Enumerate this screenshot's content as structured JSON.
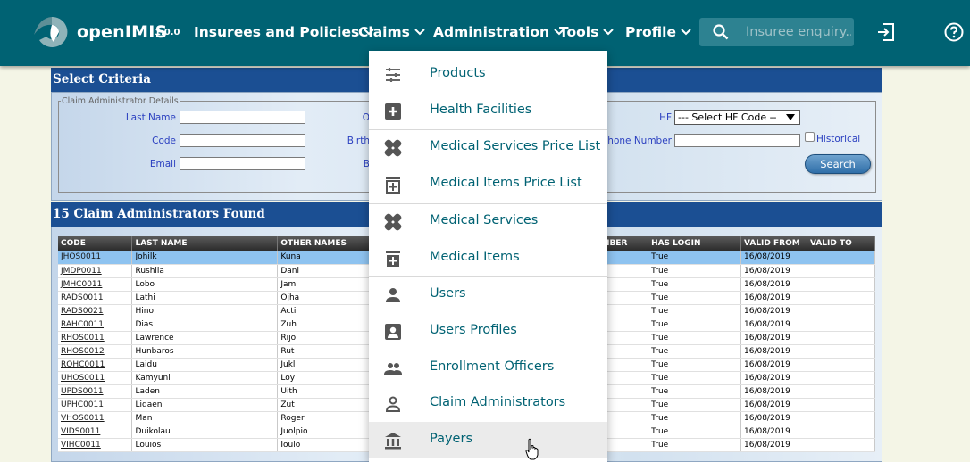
{
  "app": {
    "brand": "openIMIS",
    "version": "1.0.0",
    "nav": [
      "Insurees and Policies",
      "Claims",
      "Administration",
      "Tools",
      "Profile"
    ],
    "search_placeholder": "Insuree enquiry...",
    "colors": {
      "appbar": "#006273",
      "menu_text": "#006273",
      "panel_header": "#1b4f93"
    }
  },
  "criteria": {
    "header": "Select Criteria",
    "legend": "Claim Administrator Details",
    "labels": {
      "last_name": "Last Name",
      "code": "Code",
      "email": "Email",
      "col2_row1": "O",
      "col2_row2": "Birth",
      "col2_row3": "B",
      "hf": "HF",
      "phone": "Phone Number",
      "historical": "Historical"
    },
    "hf_select": "--- Select HF Code --",
    "search_button": "Search"
  },
  "results": {
    "header": "15 Claim Administrators Found",
    "columns": [
      "CODE",
      "LAST NAME",
      "OTHER NAMES",
      "IBER",
      "HAS LOGIN",
      "VALID FROM",
      "VALID TO"
    ],
    "rows": [
      [
        "JHOS0011",
        "Johilk",
        "Kuna",
        "True",
        "16/08/2019"
      ],
      [
        "JMDP0011",
        "Rushila",
        "Dani",
        "True",
        "16/08/2019"
      ],
      [
        "JMHC0011",
        "Lobo",
        "Jami",
        "True",
        "16/08/2019"
      ],
      [
        "RADS0011",
        "Lathi",
        "Ojha",
        "True",
        "16/08/2019"
      ],
      [
        "RADS0021",
        "Hino",
        "Acti",
        "True",
        "16/08/2019"
      ],
      [
        "RAHC0011",
        "Dias",
        "Zuh",
        "True",
        "16/08/2019"
      ],
      [
        "RHOS0011",
        "Lawrence",
        "Rijo",
        "True",
        "16/08/2019"
      ],
      [
        "RHOS0012",
        "Hunbaros",
        "Rut",
        "True",
        "16/08/2019"
      ],
      [
        "ROHC0011",
        "Laidu",
        "Jukl",
        "True",
        "16/08/2019"
      ],
      [
        "UHOS0011",
        "Kamyuni",
        "Loy",
        "True",
        "16/08/2019"
      ],
      [
        "UPDS0011",
        "Laden",
        "Uith",
        "True",
        "16/08/2019"
      ],
      [
        "UPHC0011",
        "Lidaen",
        "Zut",
        "True",
        "16/08/2019"
      ],
      [
        "VHOS0011",
        "Man",
        "Roger",
        "True",
        "16/08/2019"
      ],
      [
        "VIDS0011",
        "Duikolau",
        "Juolpio",
        "True",
        "16/08/2019"
      ],
      [
        "VIHC0011",
        "Louios",
        "Ioulo",
        "True",
        "16/08/2019"
      ]
    ]
  },
  "menu": {
    "items": [
      {
        "label": "Products",
        "icon": "tune-icon"
      },
      {
        "label": "Health Facilities",
        "icon": "local-hospital-icon"
      },
      {
        "label": "Medical Services Price List",
        "icon": "healing-icon"
      },
      {
        "label": "Medical Items Price List",
        "icon": "medication-add-icon"
      },
      {
        "label": "Medical Services",
        "icon": "healing-icon"
      },
      {
        "label": "Medical Items",
        "icon": "medication-add-icon"
      },
      {
        "label": "Users",
        "icon": "person-icon"
      },
      {
        "label": "Users Profiles",
        "icon": "account-box-icon"
      },
      {
        "label": "Enrollment Officers",
        "icon": "people-icon"
      },
      {
        "label": "Claim Administrators",
        "icon": "person-outline-icon"
      },
      {
        "label": "Payers",
        "icon": "bank-icon"
      }
    ]
  }
}
